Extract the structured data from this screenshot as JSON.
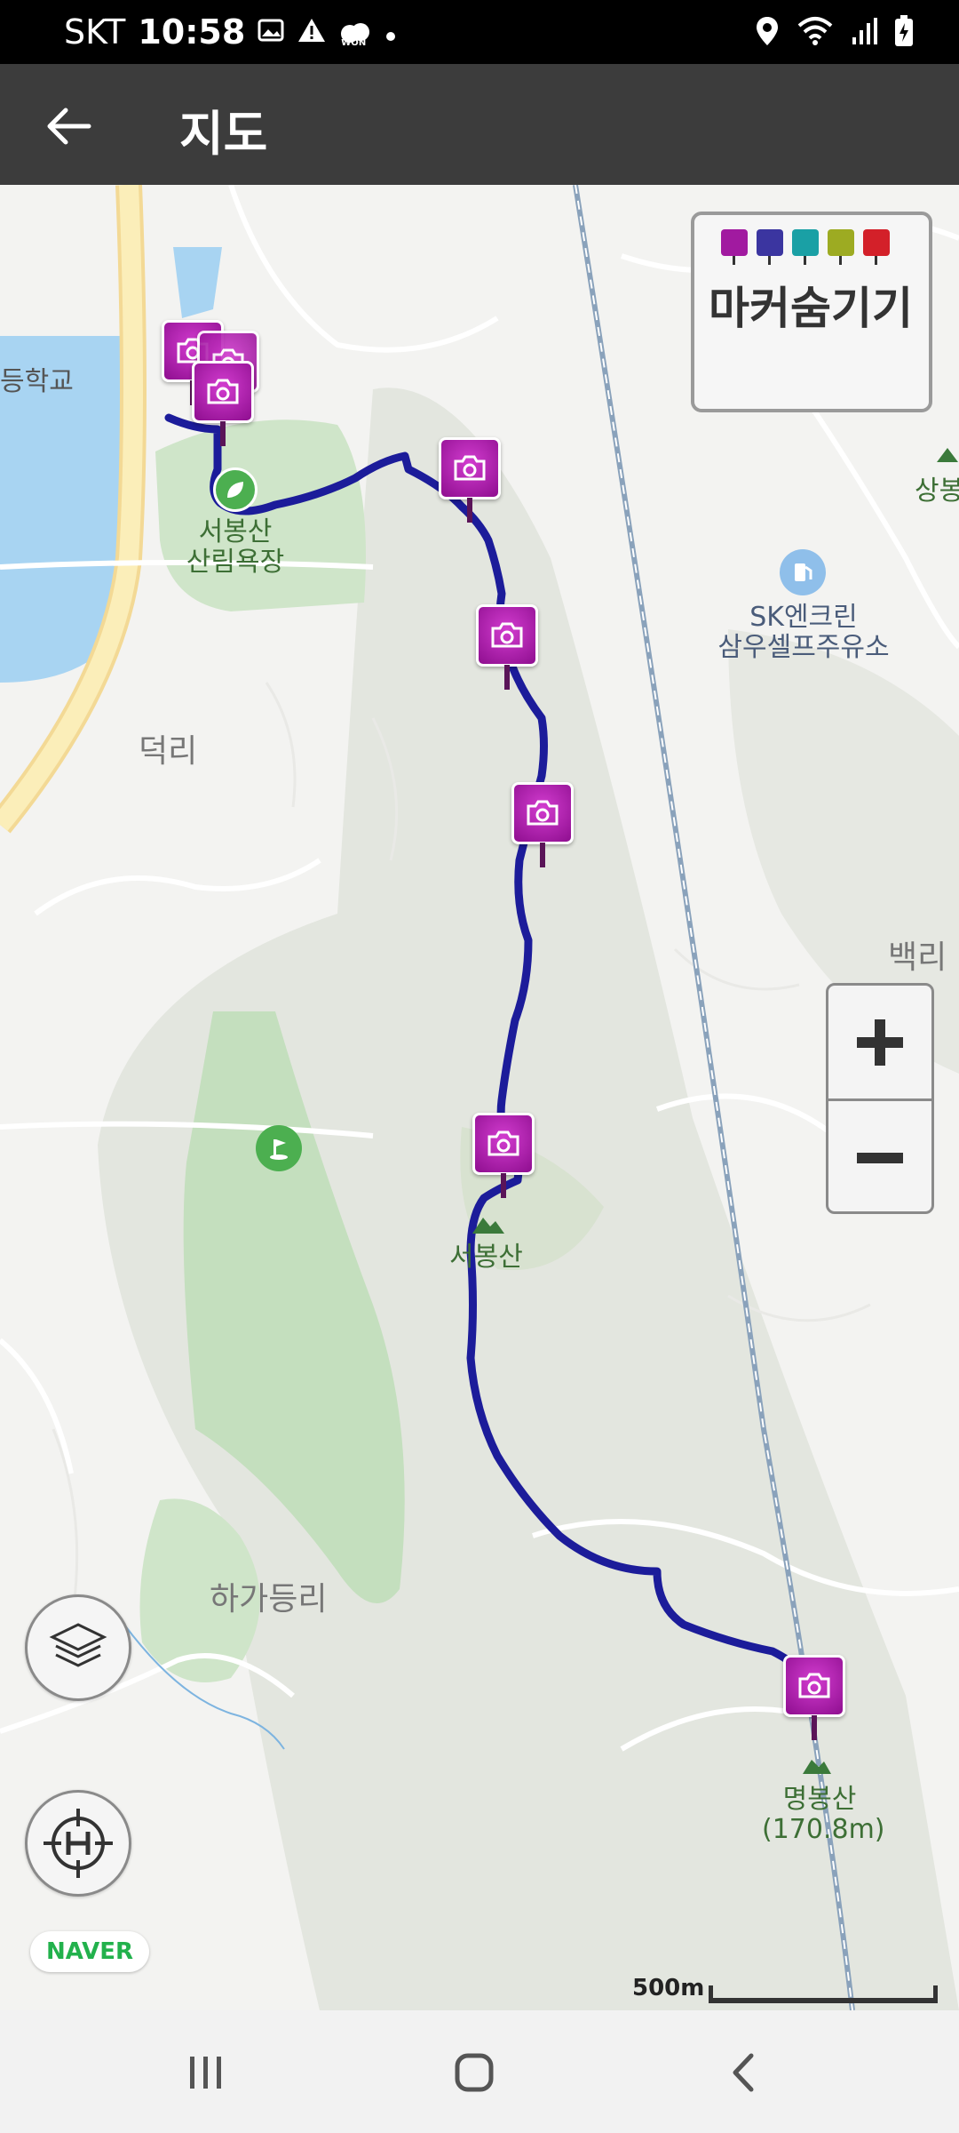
{
  "status_bar": {
    "carrier": "SKT",
    "time": "10:58",
    "won_label": "WON"
  },
  "app_bar": {
    "title": "지도"
  },
  "legend": {
    "label": "마커숨기기"
  },
  "map_labels": {
    "school": "등학교",
    "forest_bath": "서봉산\n산림욕장",
    "deokri": "덕리",
    "gas_station": "SK엔크린\n삼우셀프주유소",
    "sangbong": "상봉",
    "baekri": "백리",
    "seobongsan": "서봉산",
    "hagadeungri": "하가등리",
    "myeongbongsan": "명봉산\n(170.8m)"
  },
  "zoom": {
    "in_icon": "plus-icon",
    "out_icon": "minus-icon"
  },
  "attribution": "NAVER",
  "scale": {
    "label": "500m"
  },
  "colors": {
    "route": "#1c1c9a",
    "marker": "#a11aa0",
    "app_bar": "#3c3c3c",
    "park": "#c9e3c3",
    "water": "#a8d4f2"
  }
}
